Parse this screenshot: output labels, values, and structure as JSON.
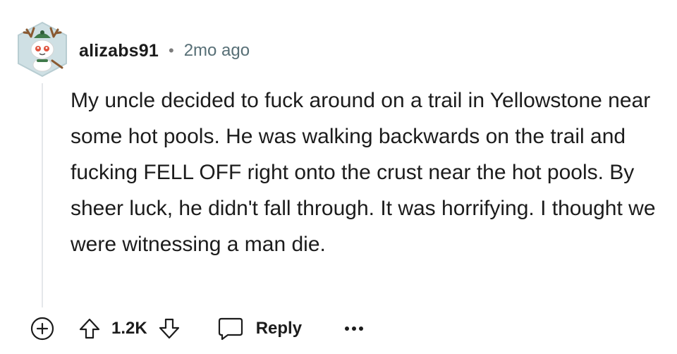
{
  "comment": {
    "author": "alizabs91",
    "separator": "•",
    "timestamp": "2mo ago",
    "text": "My uncle decided to fuck around on a trail in Yellowstone near some hot pools. He was walking backwards on the trail and fucking FELL OFF right onto the crust near the hot pools. By sheer luck, he didn't fall through. It was horrifying. I thought we were witnessing a man die.",
    "score": "1.2K",
    "reply_label": "Reply"
  },
  "icons": {
    "expand": "plus-circle-icon",
    "upvote": "arrow-up-icon",
    "downvote": "arrow-down-icon",
    "reply": "speech-bubble-icon",
    "more": "ellipsis-icon"
  },
  "colors": {
    "text": "#1c1c1c",
    "meta": "#576f76",
    "thread_line": "#e5e7ea",
    "avatar_bg": "#cfe0e4"
  }
}
